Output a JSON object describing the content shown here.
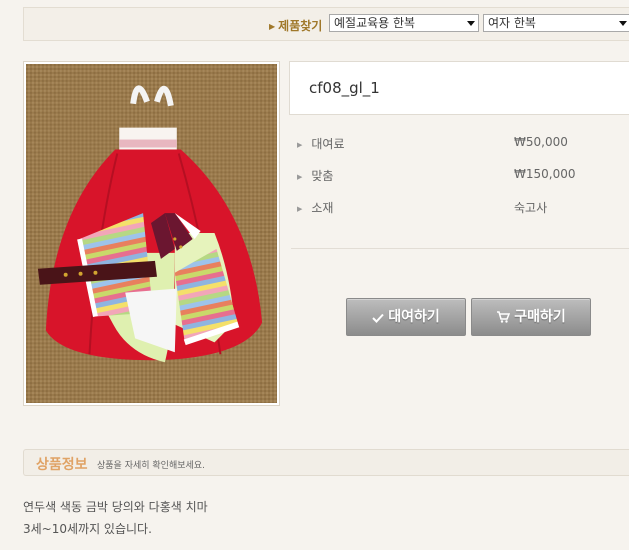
{
  "filter": {
    "label": "제품찾기",
    "select1": "예절교육용 한복",
    "select2": "여자 한복"
  },
  "product": {
    "code": "cf08_gl_1",
    "specs": [
      {
        "label": "대여료",
        "value": "₩50,000"
      },
      {
        "label": "맞춤",
        "value": "₩150,000"
      },
      {
        "label": "소재",
        "value": "숙고사"
      }
    ],
    "buttons": {
      "rent": "대여하기",
      "buy": "구매하기"
    }
  },
  "details": {
    "title": "상품정보",
    "subtitle": "상품을 자세히 확인해보세요.",
    "lines": [
      "연두색 색동 금박 당의와 다홍색 치마",
      "3세~10세까지 있습니다."
    ]
  }
}
